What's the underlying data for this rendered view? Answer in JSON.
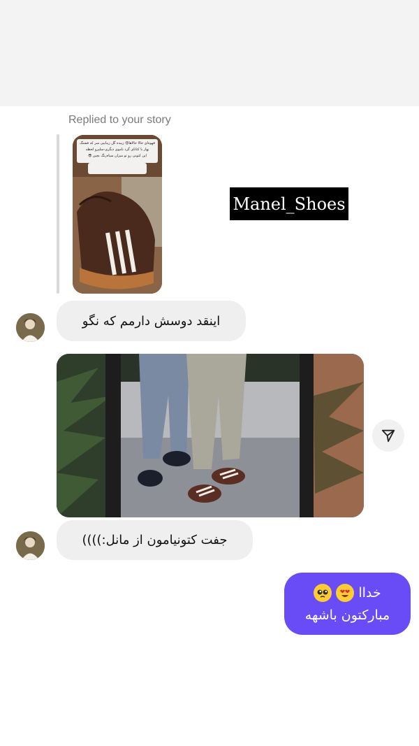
{
  "replied_label": "Replied to your story",
  "story": {
    "overlay_lines": [
      "قهوه‌ای خالا خالاها😍 زیبده گل زیباییی سر که فشنگ",
      "بهار با کتانای گرد ناموی دیگری-سلپرو لحظه",
      "این کتونی رو تو میزان سیاه‌رنگ بچین 😎"
    ]
  },
  "watermark": "Manel_Shoes",
  "messages": [
    {
      "type": "incoming",
      "text": "اینقد دوسش دارمم که نگو"
    },
    {
      "type": "incoming",
      "text": "جفت کتونیامون از مانل:))))"
    },
    {
      "type": "outgoing",
      "line1": "خداا",
      "line2": "مبارکتون باشهه",
      "emojis": [
        "smiling-face-with-heart-eyes",
        "pleading-face"
      ]
    }
  ],
  "colors": {
    "outgoing_bubble": "#6a4cf6",
    "incoming_bubble": "#efefef",
    "top_band": "#f3f3f3"
  },
  "icons": {
    "share": "share-arrow-icon"
  }
}
